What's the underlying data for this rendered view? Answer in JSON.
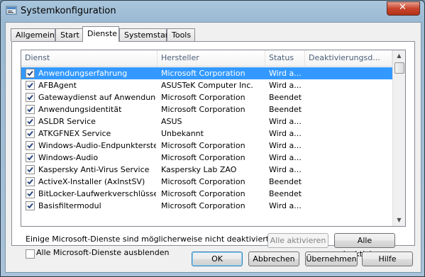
{
  "window": {
    "title": "Systemkonfiguration",
    "close_glyph": "✕",
    "app_icon": "msconfig-icon"
  },
  "tabs": [
    {
      "label": "Allgemein"
    },
    {
      "label": "Start"
    },
    {
      "label": "Dienste",
      "active": true
    },
    {
      "label": "Systemstart"
    },
    {
      "label": "Tools"
    }
  ],
  "services_table": {
    "columns": [
      "Dienst",
      "Hersteller",
      "Status",
      "Deaktivierungsd..."
    ],
    "rows": [
      {
        "name": "Anwendungserfahrung",
        "vendor": "Microsoft Corporation",
        "status": "Wird a...",
        "checked": true,
        "selected": true
      },
      {
        "name": "AFBAgent",
        "vendor": "ASUSTeK Computer Inc.",
        "status": "Wird a...",
        "checked": true
      },
      {
        "name": "Gatewaydienst auf Anwendungs...",
        "vendor": "Microsoft Corporation",
        "status": "Beendet",
        "checked": true
      },
      {
        "name": "Anwendungsidentität",
        "vendor": "Microsoft Corporation",
        "status": "Beendet",
        "checked": true
      },
      {
        "name": "ASLDR Service",
        "vendor": "ASUS",
        "status": "Wird a...",
        "checked": true
      },
      {
        "name": "ATKGFNEX Service",
        "vendor": "Unbekannt",
        "status": "Wird a...",
        "checked": true
      },
      {
        "name": "Windows-Audio-Endpunkterstell...",
        "vendor": "Microsoft Corporation",
        "status": "Wird a...",
        "checked": true
      },
      {
        "name": "Windows-Audio",
        "vendor": "Microsoft Corporation",
        "status": "Wird a...",
        "checked": true
      },
      {
        "name": "Kaspersky Anti-Virus Service",
        "vendor": "Kaspersky Lab ZAO",
        "status": "Wird a...",
        "checked": true
      },
      {
        "name": "ActiveX-Installer (AxInstSV)",
        "vendor": "Microsoft Corporation",
        "status": "Beendet",
        "checked": true
      },
      {
        "name": "BitLocker-Laufwerkverschlüsselu...",
        "vendor": "Microsoft Corporation",
        "status": "Beendet",
        "checked": true
      },
      {
        "name": "Basisfiltermodul",
        "vendor": "Microsoft Corporation",
        "status": "Wird a...",
        "checked": true
      }
    ]
  },
  "note": "Einige Microsoft-Dienste sind möglicherweise nicht deaktiviert.",
  "buttons": {
    "enable_all": "Alle aktivieren",
    "disable_all": "Alle deaktivieren",
    "ok": "OK",
    "cancel": "Abbrechen",
    "apply": "Übernehmen",
    "help": "Hilfe"
  },
  "hide_ms_services": {
    "label": "Alle Microsoft-Dienste ausblenden",
    "checked": false
  },
  "colors": {
    "selection": "#3399ff",
    "close_button": "#c9442c"
  }
}
